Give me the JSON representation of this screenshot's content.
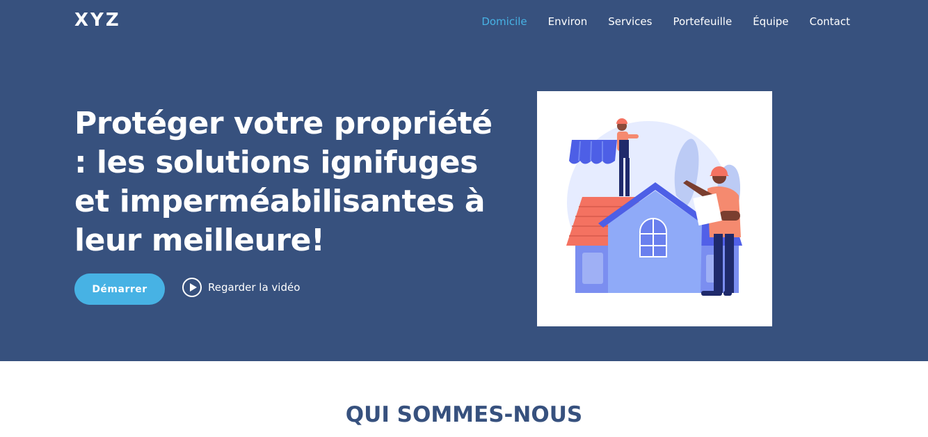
{
  "header": {
    "logo": "XYZ",
    "nav": [
      {
        "label": "Domicile",
        "active": true
      },
      {
        "label": "Environ"
      },
      {
        "label": "Services"
      },
      {
        "label": "Portefeuille"
      },
      {
        "label": "Équipe"
      },
      {
        "label": "Contact"
      }
    ]
  },
  "hero": {
    "headline": "Protéger votre propriété : les solutions ignifuges et imperméabilisantes à leur meilleure!",
    "start_button": "Démarrer",
    "watch_video": "Regarder la vidéo",
    "illustration_icon": "house-roofers-illustration"
  },
  "about": {
    "title": "QUI SOMMES-NOUS"
  },
  "colors": {
    "primary": "#37517e",
    "accent": "#47b2e4",
    "text_light": "#ffffff"
  }
}
